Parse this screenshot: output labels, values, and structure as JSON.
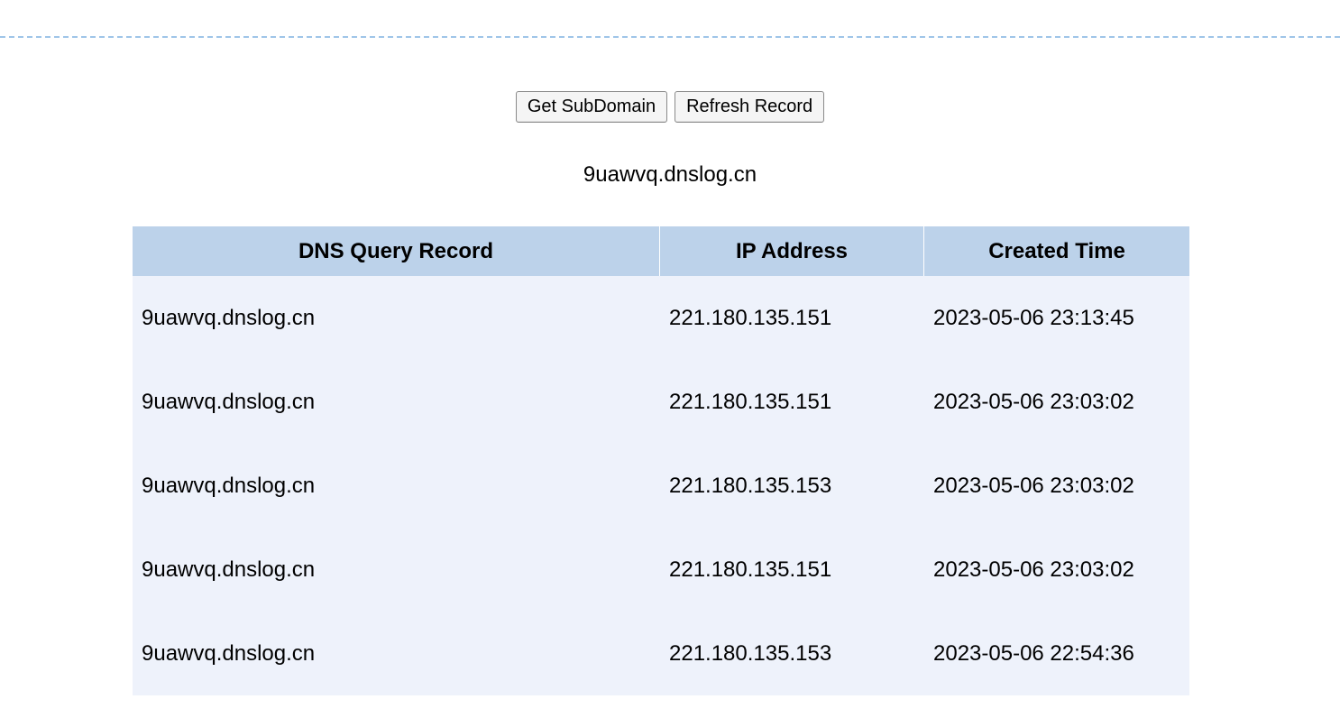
{
  "toolbar": {
    "get_subdomain_label": "Get SubDomain",
    "refresh_record_label": "Refresh Record"
  },
  "subdomain": "9uawvq.dnslog.cn",
  "table": {
    "headers": [
      "DNS Query Record",
      "IP Address",
      "Created Time"
    ],
    "rows": [
      {
        "record": "9uawvq.dnslog.cn",
        "ip": "221.180.135.151",
        "time": "2023-05-06 23:13:45"
      },
      {
        "record": "9uawvq.dnslog.cn",
        "ip": "221.180.135.151",
        "time": "2023-05-06 23:03:02"
      },
      {
        "record": "9uawvq.dnslog.cn",
        "ip": "221.180.135.153",
        "time": "2023-05-06 23:03:02"
      },
      {
        "record": "9uawvq.dnslog.cn",
        "ip": "221.180.135.151",
        "time": "2023-05-06 23:03:02"
      },
      {
        "record": "9uawvq.dnslog.cn",
        "ip": "221.180.135.153",
        "time": "2023-05-06 22:54:36"
      }
    ]
  }
}
